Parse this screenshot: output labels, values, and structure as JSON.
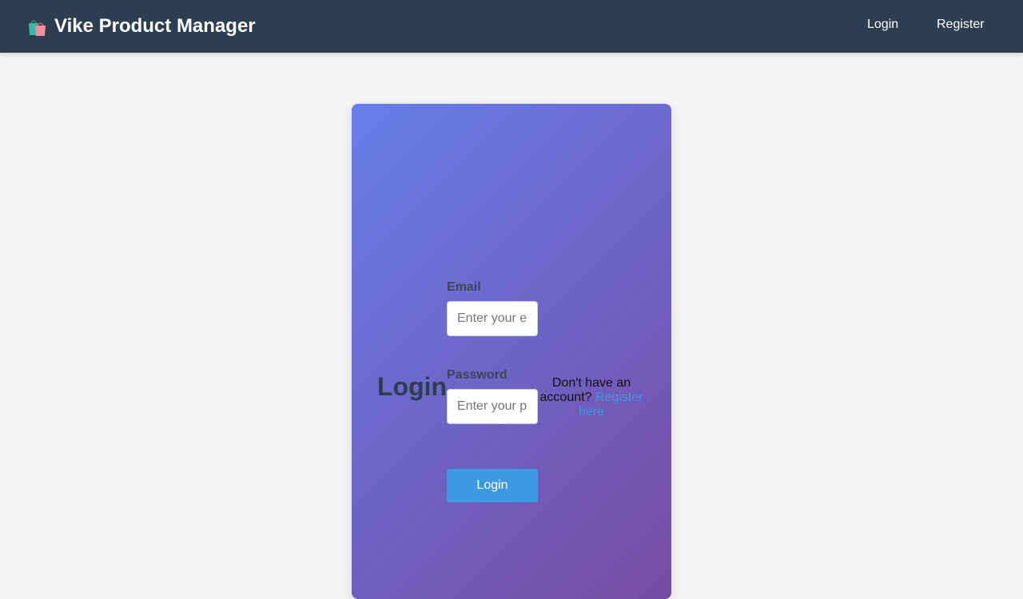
{
  "navbar": {
    "brand_icon": "shopping-bags-icon",
    "brand_title": "Vike Product Manager",
    "links": {
      "login": "Login",
      "register": "Register"
    }
  },
  "login_form": {
    "title": "Login",
    "email": {
      "label": "Email",
      "placeholder": "Enter your email",
      "value": ""
    },
    "password": {
      "label": "Password",
      "placeholder": "Enter your password",
      "value": ""
    },
    "submit_label": "Login",
    "register_prompt": "Don't have an account?",
    "register_link": "Register here"
  },
  "colors": {
    "navbar_bg": "#2d3e50",
    "page_bg": "#f4f4f4",
    "card_gradient_start": "#667eea",
    "card_gradient_end": "#764ba2",
    "accent": "#3b9ae1"
  }
}
